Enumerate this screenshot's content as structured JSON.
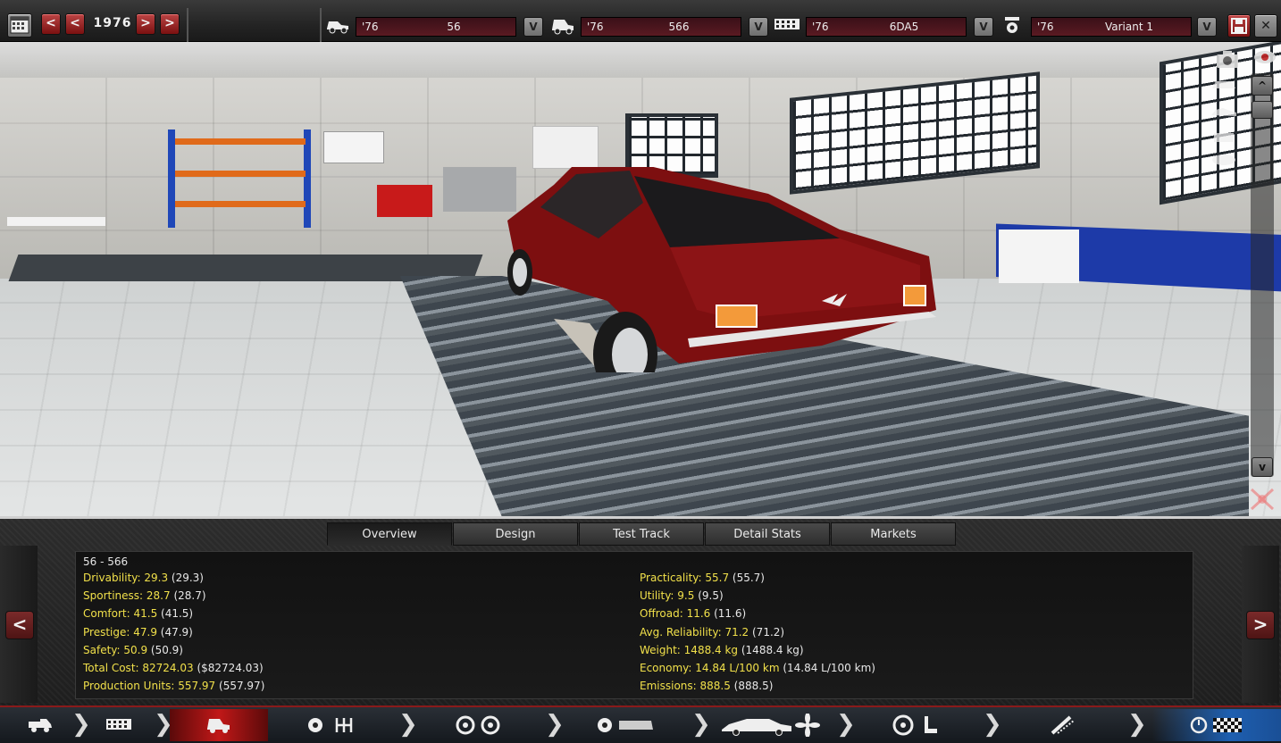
{
  "topbar": {
    "year": "1976",
    "prev_fast": "<",
    "prev": "<",
    "next": ">",
    "next_fast": ">",
    "dropdown_label": "V",
    "save_icon": "floppy-icon",
    "close_label": "✕",
    "selectors": [
      {
        "year": "'76",
        "name": "56"
      },
      {
        "year": "'76",
        "name": "566"
      },
      {
        "year": "'76",
        "name": "6DA5"
      },
      {
        "year": "'76",
        "name": "Variant 1"
      }
    ]
  },
  "viewport": {
    "scroll_up": "^",
    "scroll_down": "v"
  },
  "panel": {
    "tabs": [
      "Overview",
      "Design",
      "Test Track",
      "Detail Stats",
      "Markets"
    ],
    "active_tab": "Overview",
    "prev_label": "<",
    "next_label": ">",
    "title": "56 - 566",
    "left_stats": [
      {
        "label": "Drivability: ",
        "value": "29.3",
        "paren": " (29.3)"
      },
      {
        "label": "Sportiness: ",
        "value": "28.7",
        "paren": " (28.7)"
      },
      {
        "label": "Comfort: ",
        "value": "41.5",
        "paren": " (41.5)"
      },
      {
        "label": "Prestige: ",
        "value": "47.9",
        "paren": " (47.9)"
      },
      {
        "label": "Safety: ",
        "value": "50.9",
        "paren": " (50.9)"
      },
      {
        "label": "Total Cost: ",
        "value": "82724.03",
        "paren": " ($82724.03)"
      },
      {
        "label": "Production Units: ",
        "value": "557.97",
        "paren": " (557.97)"
      }
    ],
    "right_stats": [
      {
        "label": "Practicality: ",
        "value": "55.7",
        "paren": " (55.7)"
      },
      {
        "label": "Utility: ",
        "value": "9.5",
        "paren": " (9.5)"
      },
      {
        "label": "Offroad: ",
        "value": "11.6",
        "paren": " (11.6)"
      },
      {
        "label": "Avg. Reliability: ",
        "value": "71.2",
        "paren": " (71.2)"
      },
      {
        "label": "Weight: ",
        "value": "1488.4 kg",
        "paren": " (1488.4 kg)"
      },
      {
        "label": "Economy: ",
        "value": "14.84 L/100 km",
        "paren": " (14.84 L/100 km)"
      },
      {
        "label": "Emissions: ",
        "value": "888.5",
        "paren": " (888.5)"
      }
    ]
  },
  "bottomnav": {
    "chevron": "❯",
    "items": [
      {
        "icon": "truck-icon"
      },
      {
        "icon": "chassis-icon"
      },
      {
        "icon": "car-model-icon",
        "active": true
      },
      {
        "icon": "engine-gears-icon"
      },
      {
        "icon": "wheels-icon"
      },
      {
        "icon": "engine-block-icon"
      },
      {
        "icon": "car-body-icon"
      },
      {
        "icon": "steering-seat-icon"
      },
      {
        "icon": "suspension-icon"
      },
      {
        "icon": "test-flag-icon"
      }
    ]
  },
  "colors": {
    "accent_red": "#c11818",
    "stat_yellow": "#f1e04a"
  }
}
